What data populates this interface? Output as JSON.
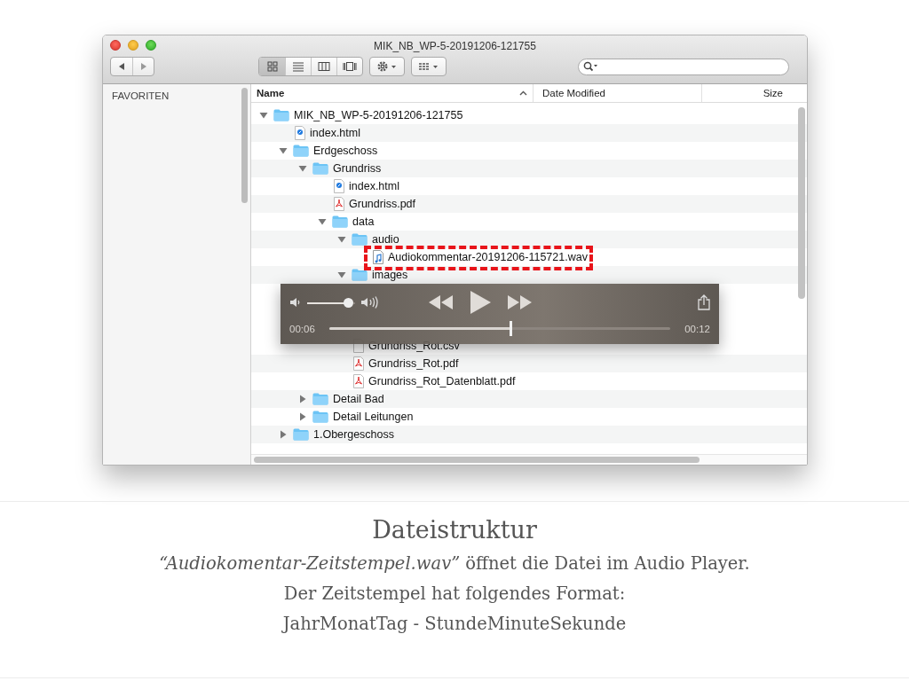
{
  "window": {
    "title": "MIK_NB_WP-5-20191206-121755"
  },
  "toolbar": {
    "view_modes": [
      {
        "kind": "icons",
        "selected": true
      },
      {
        "kind": "list",
        "selected": false
      },
      {
        "kind": "columns",
        "selected": false
      },
      {
        "kind": "coverflow",
        "selected": false
      }
    ]
  },
  "sidebar": {
    "heading": "FAVORITEN"
  },
  "columns": [
    {
      "label": "Name",
      "sorted": true
    },
    {
      "label": "Date Modified",
      "sorted": false
    },
    {
      "label": "Size",
      "sorted": false
    }
  ],
  "tree": [
    {
      "name": "MIK_NB_WP-5-20191206-121755",
      "kind": "folder",
      "expanded": true,
      "children": [
        {
          "name": "index.html",
          "kind": "html"
        },
        {
          "name": "Erdgeschoss",
          "kind": "folder",
          "expanded": true,
          "children": [
            {
              "name": "Grundriss",
              "kind": "folder",
              "expanded": true,
              "children": [
                {
                  "name": "index.html",
                  "kind": "html"
                },
                {
                  "name": "Grundriss.pdf",
                  "kind": "pdf"
                },
                {
                  "name": "data",
                  "kind": "folder",
                  "expanded": true,
                  "children": [
                    {
                      "name": "audio",
                      "kind": "folder",
                      "expanded": true,
                      "children": [
                        {
                          "name": "Audiokommentar-20191206-115721.wav",
                          "kind": "audio",
                          "highlighted": true
                        }
                      ]
                    },
                    {
                      "name": "images",
                      "kind": "folder",
                      "expanded": true,
                      "audio_player_follows": true
                    },
                    {
                      "name": "Grundriss_Rot.csv",
                      "kind": "file"
                    },
                    {
                      "name": "Grundriss_Rot.pdf",
                      "kind": "pdf"
                    },
                    {
                      "name": "Grundriss_Rot_Datenblatt.pdf",
                      "kind": "pdf"
                    }
                  ]
                }
              ]
            },
            {
              "name": "Detail Bad",
              "kind": "folder",
              "expanded": false
            },
            {
              "name": "Detail Leitungen",
              "kind": "folder",
              "expanded": false
            }
          ]
        },
        {
          "name": "1.Obergeschoss",
          "kind": "folder",
          "expanded": false
        }
      ]
    }
  ],
  "audio_player": {
    "volume": {
      "level": 0.87
    },
    "elapsed": "00:06",
    "progress": {
      "level": 0.53
    },
    "remaining": "00:12"
  },
  "caption": {
    "title": "Dateistruktur",
    "lines": [
      "*“Audiokomentar-Zeitstempel.wav”* öffnet die Datei im Audio Player.",
      "Der Zeitstempel hat folgendes Format:",
      "JahrMonatTag - StundeMinuteSekunde"
    ]
  }
}
